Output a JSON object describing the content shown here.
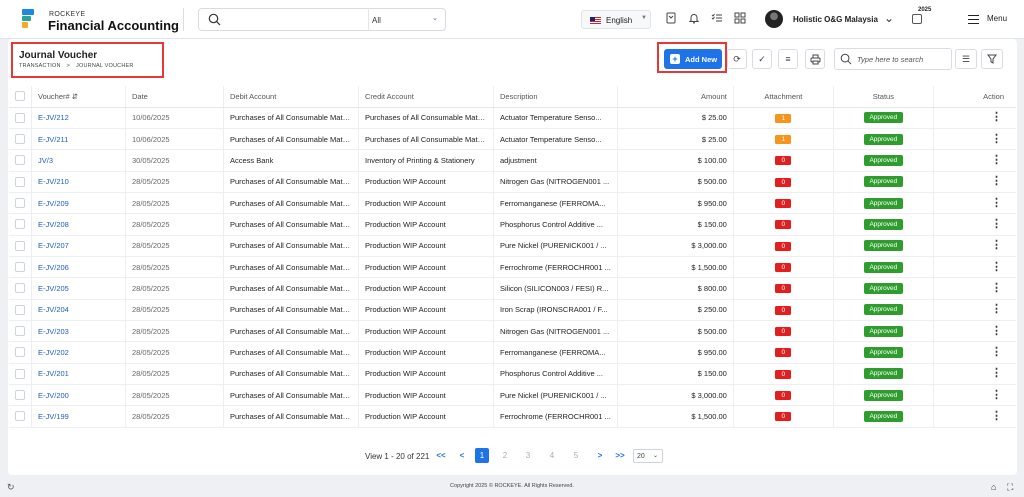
{
  "brand": {
    "top": "ROCKEYE",
    "name": "Financial Accounting"
  },
  "search": {
    "scope": "All"
  },
  "language": "English",
  "user": {
    "name": "Holistic O&G Malaysia"
  },
  "year": "2025",
  "menu_label": "Menu",
  "page": {
    "title": "Journal Voucher",
    "breadcrumb": [
      "TRANSACTION",
      "JOURNAL VOUCHER"
    ],
    "add_new": "Add New",
    "table_search_placeholder": "Type here to search"
  },
  "table": {
    "headers": [
      "Voucher#",
      "Date",
      "Debit Account",
      "Credit Account",
      "Description",
      "Amount",
      "Attachment",
      "Status",
      "Action"
    ],
    "rows": [
      {
        "voucher": "E-JV/212",
        "date": "10/06/2025",
        "debit": "Purchases of All Consumable Mate...",
        "credit": "Purchases of All Consumable Mate...",
        "desc": "Actuator Temperature Senso...",
        "amount": "$ 25.00",
        "attach": "1",
        "attach_color": "orange",
        "status": "Approved"
      },
      {
        "voucher": "E-JV/211",
        "date": "10/06/2025",
        "debit": "Purchases of All Consumable Mate...",
        "credit": "Purchases of All Consumable Mate...",
        "desc": "Actuator Temperature Senso...",
        "amount": "$ 25.00",
        "attach": "1",
        "attach_color": "orange",
        "status": "Approved"
      },
      {
        "voucher": "JV/3",
        "date": "30/05/2025",
        "debit": "Access Bank",
        "credit": "Inventory of Printing & Stationery",
        "desc": "adjustment",
        "amount": "$ 100.00",
        "attach": "0",
        "attach_color": "red",
        "status": "Approved"
      },
      {
        "voucher": "E-JV/210",
        "date": "28/05/2025",
        "debit": "Purchases of All Consumable Mate...",
        "credit": "Production WIP Account",
        "desc": "Nitrogen Gas (NITROGEN001 ...",
        "amount": "$ 500.00",
        "attach": "0",
        "attach_color": "red",
        "status": "Approved"
      },
      {
        "voucher": "E-JV/209",
        "date": "28/05/2025",
        "debit": "Purchases of All Consumable Mate...",
        "credit": "Production WIP Account",
        "desc": "Ferromanganese (FERROMA...",
        "amount": "$ 950.00",
        "attach": "0",
        "attach_color": "red",
        "status": "Approved"
      },
      {
        "voucher": "E-JV/208",
        "date": "28/05/2025",
        "debit": "Purchases of All Consumable Mate...",
        "credit": "Production WIP Account",
        "desc": "Phosphorus Control Additive ...",
        "amount": "$ 150.00",
        "attach": "0",
        "attach_color": "red",
        "status": "Approved"
      },
      {
        "voucher": "E-JV/207",
        "date": "28/05/2025",
        "debit": "Purchases of All Consumable Mate...",
        "credit": "Production WIP Account",
        "desc": "Pure Nickel (PURENICK001 / ...",
        "amount": "$ 3,000.00",
        "attach": "0",
        "attach_color": "red",
        "status": "Approved"
      },
      {
        "voucher": "E-JV/206",
        "date": "28/05/2025",
        "debit": "Purchases of All Consumable Mate...",
        "credit": "Production WIP Account",
        "desc": "Ferrochrome (FERROCHR001 ...",
        "amount": "$ 1,500.00",
        "attach": "0",
        "attach_color": "red",
        "status": "Approved"
      },
      {
        "voucher": "E-JV/205",
        "date": "28/05/2025",
        "debit": "Purchases of All Consumable Mate...",
        "credit": "Production WIP Account",
        "desc": "Silicon (SILICON003 / FESI) R...",
        "amount": "$ 800.00",
        "attach": "0",
        "attach_color": "red",
        "status": "Approved"
      },
      {
        "voucher": "E-JV/204",
        "date": "28/05/2025",
        "debit": "Purchases of All Consumable Mate...",
        "credit": "Production WIP Account",
        "desc": "Iron Scrap (IRONSCRA001 / F...",
        "amount": "$ 250.00",
        "attach": "0",
        "attach_color": "red",
        "status": "Approved"
      },
      {
        "voucher": "E-JV/203",
        "date": "28/05/2025",
        "debit": "Purchases of All Consumable Mate...",
        "credit": "Production WIP Account",
        "desc": "Nitrogen Gas (NITROGEN001 ...",
        "amount": "$ 500.00",
        "attach": "0",
        "attach_color": "red",
        "status": "Approved"
      },
      {
        "voucher": "E-JV/202",
        "date": "28/05/2025",
        "debit": "Purchases of All Consumable Mate...",
        "credit": "Production WIP Account",
        "desc": "Ferromanganese (FERROMA...",
        "amount": "$ 950.00",
        "attach": "0",
        "attach_color": "red",
        "status": "Approved"
      },
      {
        "voucher": "E-JV/201",
        "date": "28/05/2025",
        "debit": "Purchases of All Consumable Mate...",
        "credit": "Production WIP Account",
        "desc": "Phosphorus Control Additive ...",
        "amount": "$ 150.00",
        "attach": "0",
        "attach_color": "red",
        "status": "Approved"
      },
      {
        "voucher": "E-JV/200",
        "date": "28/05/2025",
        "debit": "Purchases of All Consumable Mate...",
        "credit": "Production WIP Account",
        "desc": "Pure Nickel (PURENICK001 / ...",
        "amount": "$ 3,000.00",
        "attach": "0",
        "attach_color": "red",
        "status": "Approved"
      },
      {
        "voucher": "E-JV/199",
        "date": "28/05/2025",
        "debit": "Purchases of All Consumable Mate...",
        "credit": "Production WIP Account",
        "desc": "Ferrochrome (FERROCHR001 ...",
        "amount": "$ 1,500.00",
        "attach": "0",
        "attach_color": "red",
        "status": "Approved"
      }
    ]
  },
  "pagination": {
    "summary": "View 1 - 20 of 221",
    "pages": [
      "1",
      "2",
      "3",
      "4",
      "5"
    ],
    "first": "<<",
    "prev": "<",
    "next": ">",
    "last": ">>",
    "page_size": "20"
  },
  "footer": {
    "copyright": "Copyright 2025 © ROCKEYE. All Rights Reserved."
  },
  "colors": {
    "accent": "#1e73e8",
    "approved": "#2e9d2e",
    "badge_orange": "#f7941d",
    "badge_red": "#e02020",
    "highlight": "#e53935"
  }
}
